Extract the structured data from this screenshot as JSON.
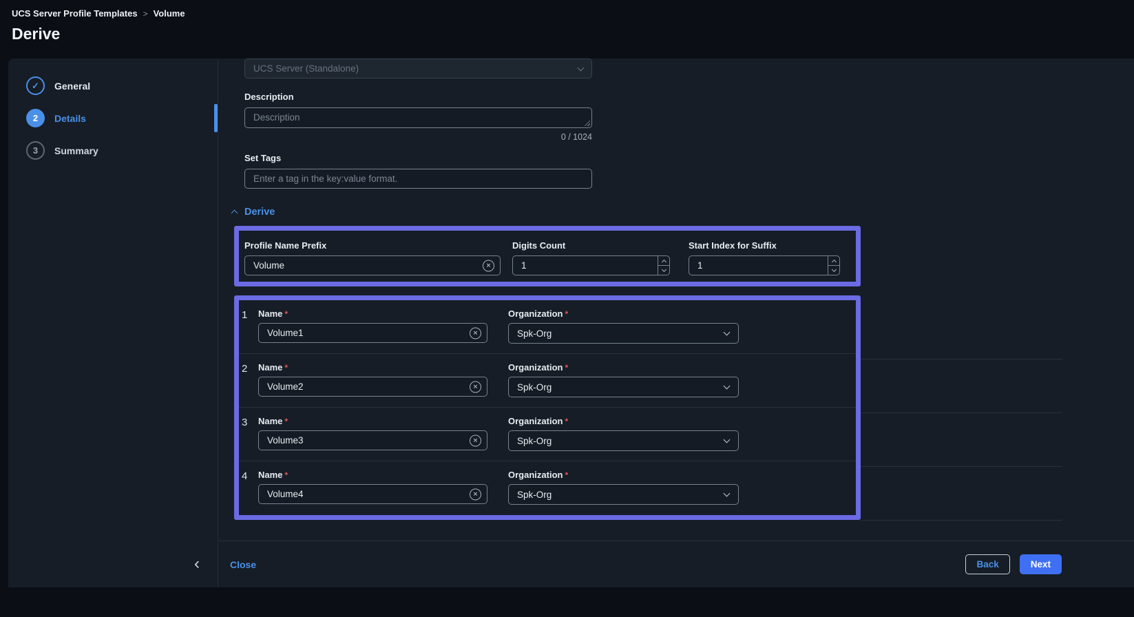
{
  "header": {
    "breadcrumb": {
      "root": "UCS Server Profile Templates",
      "separator": ">",
      "current": "Volume"
    },
    "title": "Derive"
  },
  "sidebar": {
    "steps": [
      {
        "label": "General",
        "marker": "✓",
        "state": "completed"
      },
      {
        "label": "Details",
        "marker": "2",
        "state": "active"
      },
      {
        "label": "Summary",
        "marker": "3",
        "state": "upcoming"
      }
    ]
  },
  "form": {
    "platform_select": {
      "value": "UCS Server (Standalone)"
    },
    "description": {
      "label": "Description",
      "placeholder": "Description",
      "counter": "0 / 1024"
    },
    "tags": {
      "label": "Set Tags",
      "placeholder": "Enter a tag in the key:value format."
    },
    "derive_section": {
      "title": "Derive"
    },
    "prefix": {
      "label": "Profile Name Prefix",
      "value": "Volume"
    },
    "digits_count": {
      "label": "Digits Count",
      "value": "1"
    },
    "start_index": {
      "label": "Start Index for Suffix",
      "value": "1"
    },
    "required_marker": "*",
    "rows": [
      {
        "index": "1",
        "name_label": "Name",
        "name_value": "Volume1",
        "org_label": "Organization",
        "org_value": "Spk-Org"
      },
      {
        "index": "2",
        "name_label": "Name",
        "name_value": "Volume2",
        "org_label": "Organization",
        "org_value": "Spk-Org"
      },
      {
        "index": "3",
        "name_label": "Name",
        "name_value": "Volume3",
        "org_label": "Organization",
        "org_value": "Spk-Org"
      },
      {
        "index": "4",
        "name_label": "Name",
        "name_value": "Volume4",
        "org_label": "Organization",
        "org_value": "Spk-Org"
      }
    ]
  },
  "footer": {
    "close": "Close",
    "back": "Back",
    "next": "Next"
  },
  "icons": {
    "check": "✓",
    "clear": "✕",
    "collapse": "‹"
  },
  "colors": {
    "accent_blue": "#4a90e8",
    "highlight_border": "#6b6be4",
    "next_button": "#3f6ff2",
    "required_red": "#e0564f",
    "panel_bg": "#161d26",
    "page_bg": "#0b0f15"
  }
}
